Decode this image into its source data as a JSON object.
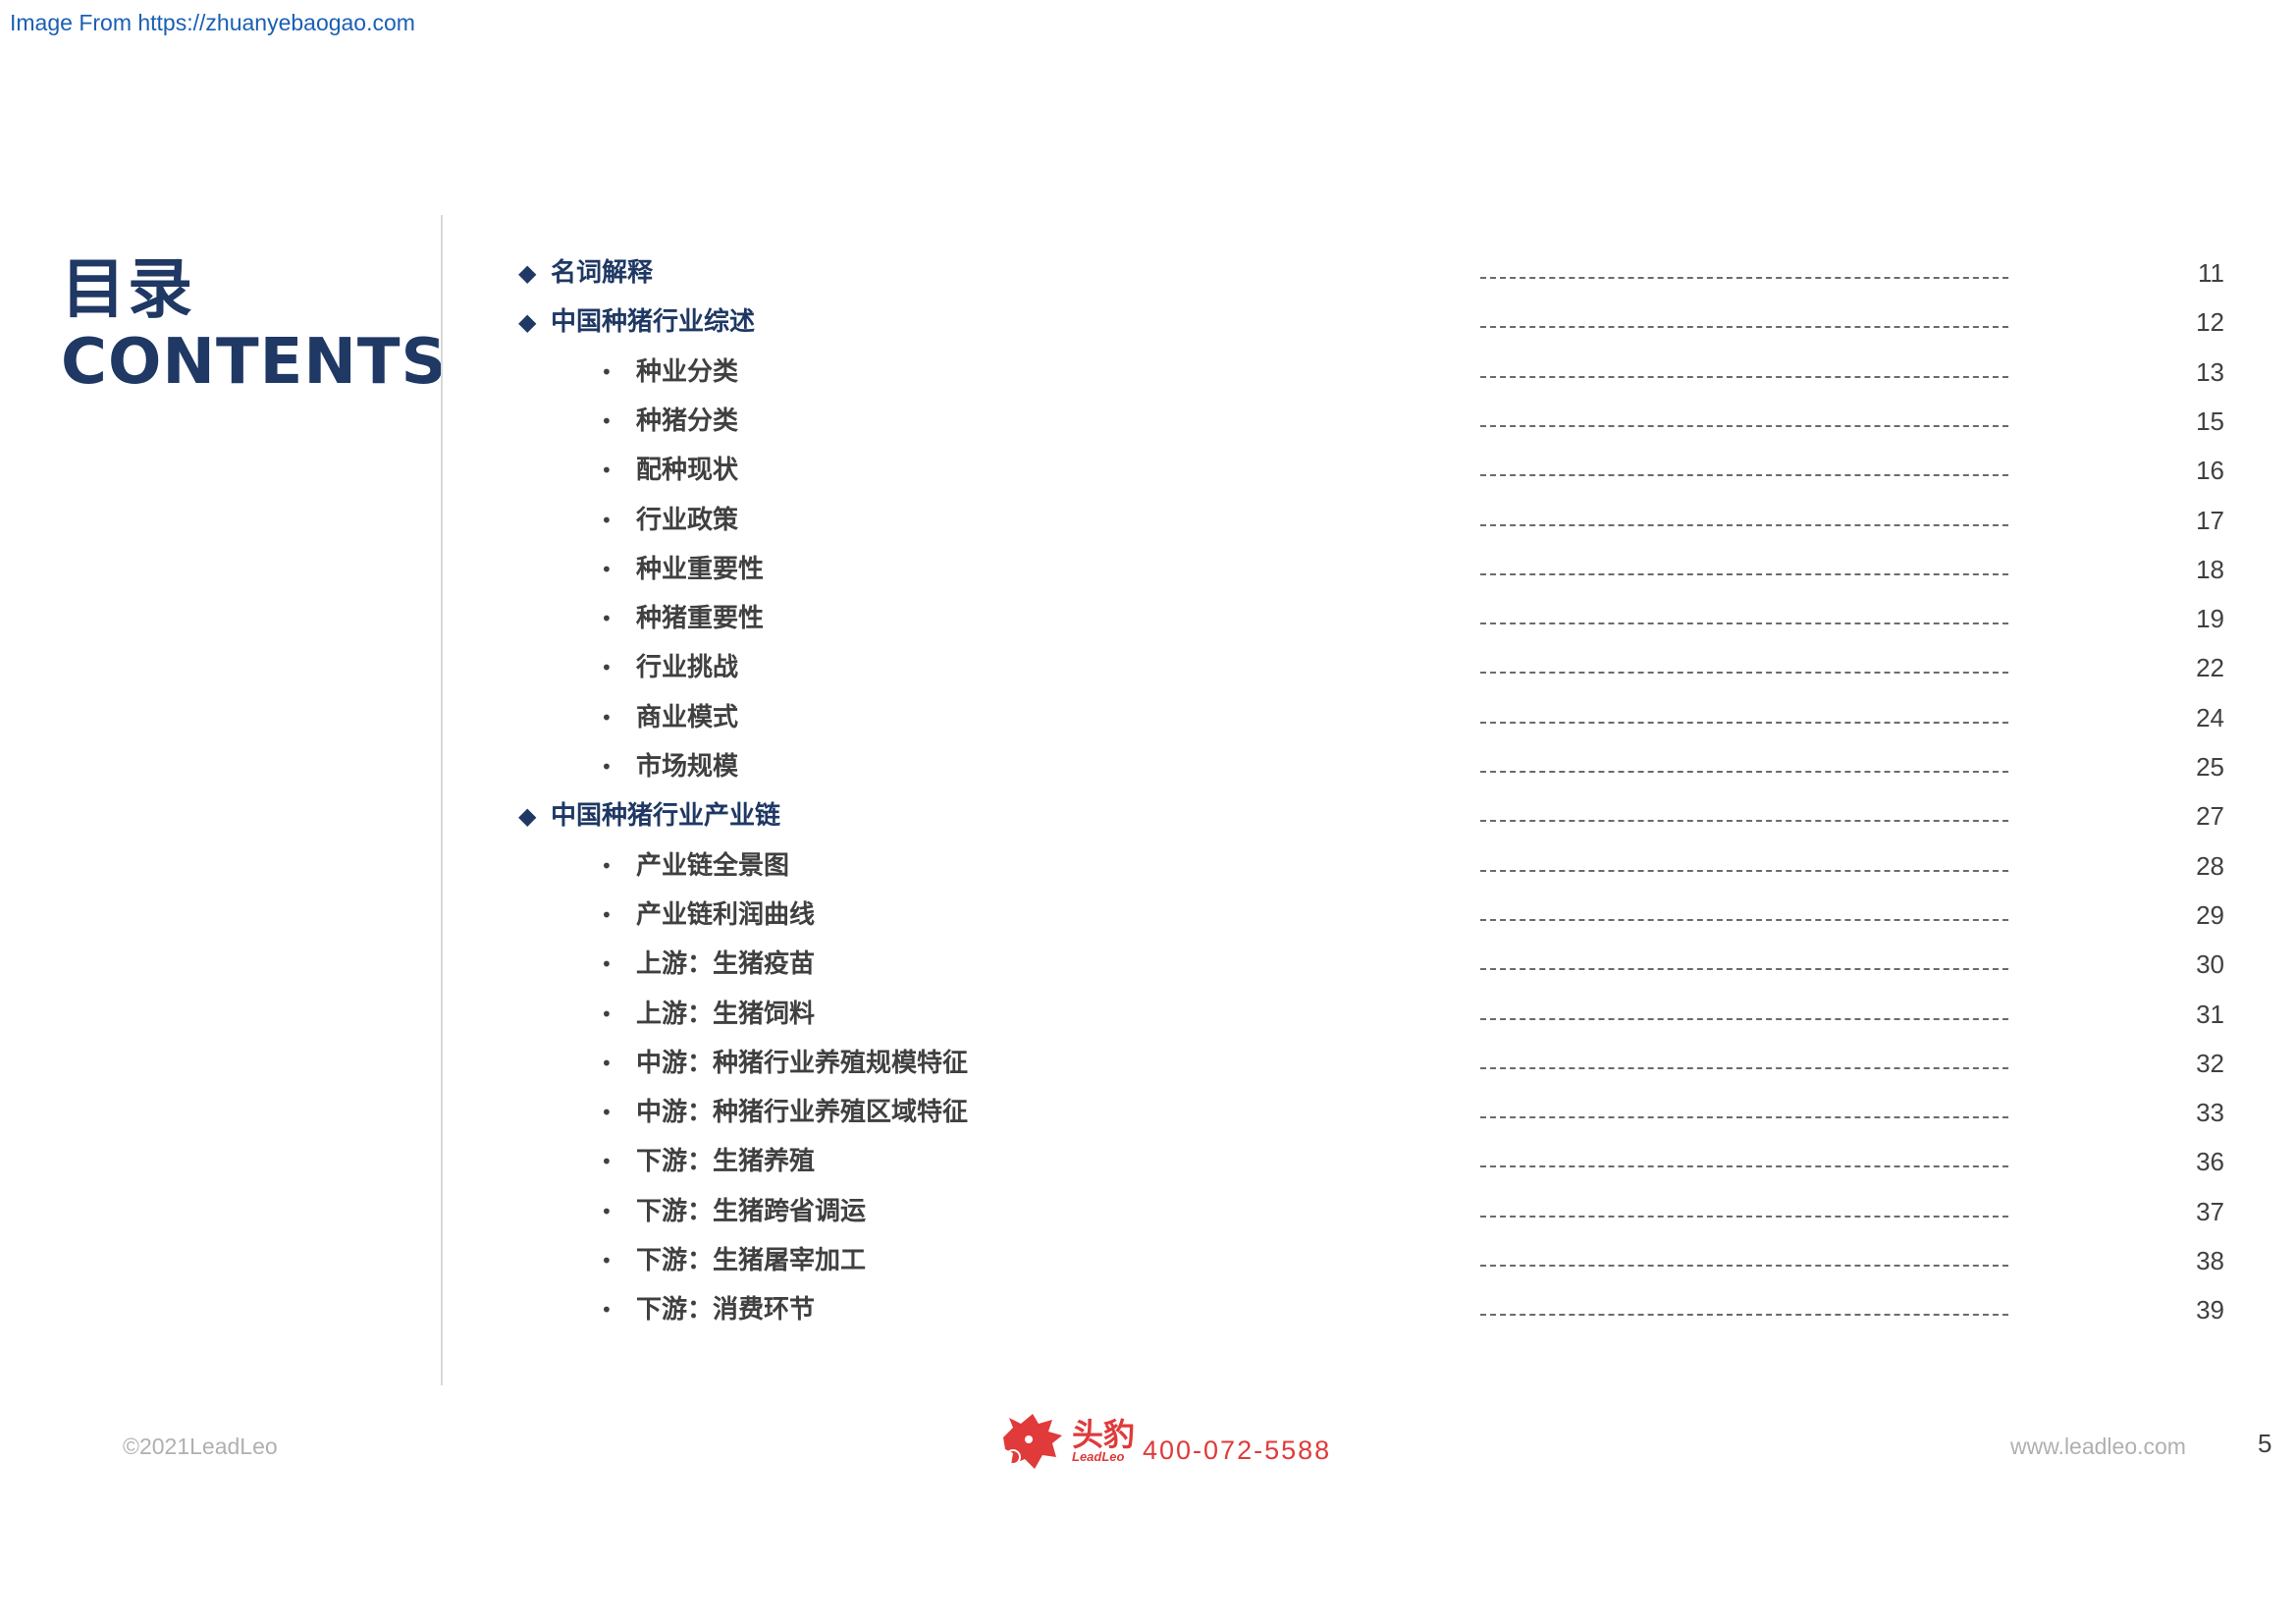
{
  "source": "Image From https://zhuanyebaogao.com",
  "title": {
    "cn": "目录",
    "en": "CONTENTS"
  },
  "toc": [
    {
      "label": "名词解释",
      "page": "11",
      "level": "section"
    },
    {
      "label": "中国种猪行业综述",
      "page": "12",
      "level": "section"
    },
    {
      "label": "种业分类",
      "page": "13",
      "level": "sub"
    },
    {
      "label": "种猪分类",
      "page": "15",
      "level": "sub"
    },
    {
      "label": "配种现状",
      "page": "16",
      "level": "sub"
    },
    {
      "label": "行业政策",
      "page": "17",
      "level": "sub"
    },
    {
      "label": "种业重要性",
      "page": "18",
      "level": "sub"
    },
    {
      "label": "种猪重要性",
      "page": "19",
      "level": "sub"
    },
    {
      "label": "行业挑战",
      "page": "22",
      "level": "sub"
    },
    {
      "label": "商业模式",
      "page": "24",
      "level": "sub"
    },
    {
      "label": "市场规模",
      "page": "25",
      "level": "sub"
    },
    {
      "label": "中国种猪行业产业链",
      "page": "27",
      "level": "section"
    },
    {
      "label": "产业链全景图",
      "page": "28",
      "level": "sub"
    },
    {
      "label": "产业链利润曲线",
      "page": "29",
      "level": "sub"
    },
    {
      "label": "上游：生猪疫苗",
      "page": "30",
      "level": "sub"
    },
    {
      "label": "上游：生猪饲料",
      "page": "31",
      "level": "sub"
    },
    {
      "label": "中游：种猪行业养殖规模特征",
      "page": "32",
      "level": "sub"
    },
    {
      "label": "中游：种猪行业养殖区域特征",
      "page": "33",
      "level": "sub"
    },
    {
      "label": "下游：生猪养殖",
      "page": "36",
      "level": "sub"
    },
    {
      "label": "下游：生猪跨省调运",
      "page": "37",
      "level": "sub"
    },
    {
      "label": "下游：生猪屠宰加工",
      "page": "38",
      "level": "sub"
    },
    {
      "label": "下游：消费环节",
      "page": "39",
      "level": "sub"
    }
  ],
  "footer": {
    "copyright": "©2021LeadLeo",
    "logo_cn": "头豹",
    "logo_en": "LeadLeo",
    "phone": "400-072-5588",
    "website": "www.leadleo.com",
    "slide_number": "5"
  },
  "colors": {
    "navy": "#1f3864",
    "body_text": "#404040",
    "brand_red": "#e03a3a",
    "muted": "#b0b0b0"
  },
  "icons": {
    "section_marker": "diamond",
    "sub_marker": "bullet",
    "logo": "leopard-head-logo"
  }
}
